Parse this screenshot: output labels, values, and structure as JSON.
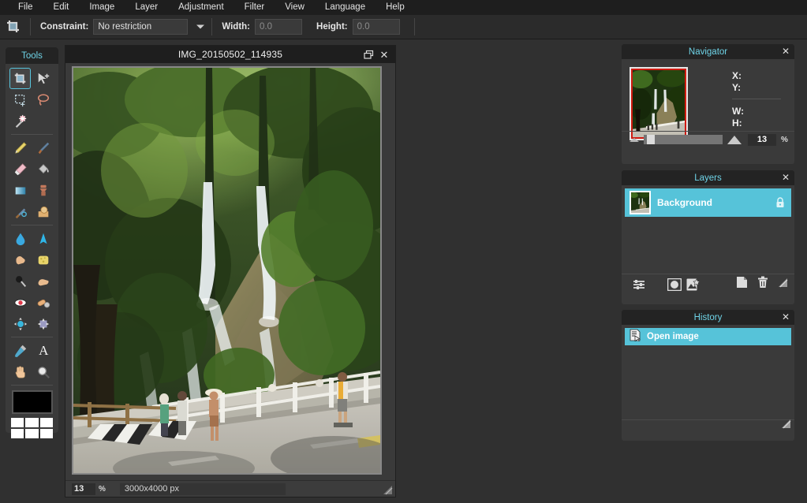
{
  "menubar": {
    "items": [
      {
        "label": "File"
      },
      {
        "label": "Edit"
      },
      {
        "label": "Image"
      },
      {
        "label": "Layer"
      },
      {
        "label": "Adjustment"
      },
      {
        "label": "Filter"
      },
      {
        "label": "View"
      },
      {
        "label": "Language"
      },
      {
        "label": "Help"
      }
    ]
  },
  "options_bar": {
    "tool_icon": "crop-tool-icon",
    "constraint_label": "Constraint:",
    "constraint_value": "No restriction",
    "width_label": "Width:",
    "width_value": "0.0",
    "height_label": "Height:",
    "height_value": "0.0"
  },
  "tools_panel": {
    "title": "Tools",
    "selected_tool": "crop",
    "tools": [
      {
        "name": "crop-tool",
        "selected": true
      },
      {
        "name": "move-tool",
        "selected": false
      },
      {
        "name": "rectangle-select-tool",
        "selected": false
      },
      {
        "name": "lasso-select-tool",
        "selected": false
      },
      {
        "name": "magic-wand-tool",
        "selected": false
      },
      {
        "name": "pencil-tool",
        "selected": false
      },
      {
        "name": "paintbrush-tool",
        "selected": false
      },
      {
        "name": "eraser-tool",
        "selected": false
      },
      {
        "name": "paint-bucket-tool",
        "selected": false
      },
      {
        "name": "gradient-tool",
        "selected": false
      },
      {
        "name": "clone-stamp-tool",
        "selected": false
      },
      {
        "name": "detail-brush-tool",
        "selected": false
      },
      {
        "name": "shape-tool",
        "selected": false
      },
      {
        "name": "blur-tool",
        "selected": false
      },
      {
        "name": "sharpen-tool",
        "selected": false
      },
      {
        "name": "smudge-tool",
        "selected": false
      },
      {
        "name": "sponge-tool",
        "selected": false
      },
      {
        "name": "dodge-tool",
        "selected": false
      },
      {
        "name": "burn-tool",
        "selected": false
      },
      {
        "name": "red-eye-tool",
        "selected": false
      },
      {
        "name": "heal-tool",
        "selected": false
      },
      {
        "name": "bloat-tool",
        "selected": false
      },
      {
        "name": "pinch-tool",
        "selected": false
      },
      {
        "name": "eyedropper-tool",
        "selected": false
      },
      {
        "name": "text-tool",
        "selected": false
      },
      {
        "name": "pan-hand-tool",
        "selected": false
      },
      {
        "name": "zoom-tool",
        "selected": false
      }
    ],
    "primary_color": "#000000",
    "palette_colors": [
      "#ffffff",
      "#ffffff",
      "#ffffff",
      "#ffffff",
      "#ffffff",
      "#ffffff"
    ]
  },
  "document": {
    "title": "IMG_20150502_114935",
    "restore_icon": "restore-window-icon",
    "close_icon": "close-icon",
    "status": {
      "zoom": "13",
      "zoom_unit": "%",
      "dimensions": "3000x4000 px"
    }
  },
  "navigator": {
    "title": "Navigator",
    "close_icon": "close-icon",
    "fields": [
      {
        "label": "X:",
        "value": ""
      },
      {
        "label": "Y:",
        "value": ""
      },
      {
        "label": "W:",
        "value": ""
      },
      {
        "label": "H:",
        "value": ""
      }
    ],
    "zoom_out_icon": "zoom-out-triangle-icon",
    "zoom_in_icon": "zoom-in-triangle-icon",
    "zoom_value": "13",
    "zoom_unit": "%",
    "viewport_border_color": "#d01a10"
  },
  "layers": {
    "title": "Layers",
    "close_icon": "close-icon",
    "rows": [
      {
        "name": "Background",
        "locked": true,
        "selected": true
      }
    ],
    "toolbar": {
      "adjustments_icon": "adjustments-sliders-icon",
      "mask_icon": "layer-mask-circle-icon",
      "effects_icon": "layer-effects-icon",
      "duplicate_icon": "duplicate-layer-icon",
      "delete_icon": "trash-icon",
      "resize_grip_icon": "resize-grip-icon"
    },
    "selected_color": "#56c3d9"
  },
  "history": {
    "title": "History",
    "close_icon": "close-icon",
    "rows": [
      {
        "label": "Open image",
        "icon": "open-image-icon",
        "selected": true
      }
    ],
    "resize_grip_icon": "resize-grip-icon"
  },
  "theme": {
    "background": "#303030",
    "panel": "#3a3a3a",
    "panel_header": "#232323",
    "accent_cyan": "#6fd4e8",
    "selection": "#56c3d9"
  }
}
